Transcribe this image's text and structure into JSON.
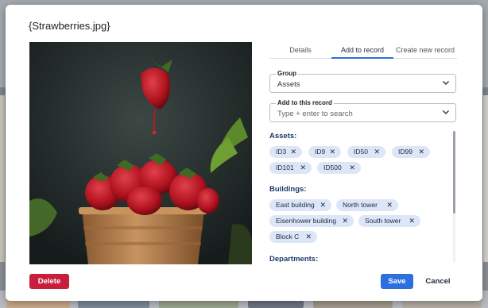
{
  "modal": {
    "title": "{Strawberries.jpg}"
  },
  "image": {
    "subject": "strawberries-in-paper-cup"
  },
  "tabs": [
    {
      "label": "Details",
      "active": false
    },
    {
      "label": "Add to record",
      "active": true
    },
    {
      "label": "Create new record",
      "active": false
    }
  ],
  "group_field": {
    "label": "Group",
    "value": "Assets"
  },
  "record_field": {
    "label": "Add to this record",
    "placeholder": "Type + enter to search"
  },
  "sections": {
    "assets": {
      "title": "Assets:",
      "chips": [
        "ID3",
        "ID9",
        "ID50",
        "ID99",
        "ID101",
        "ID500"
      ]
    },
    "buildings": {
      "title": "Buildings:",
      "chips": [
        "East building",
        "North tower",
        "Eisenhower building",
        "South tower",
        "Block C"
      ]
    },
    "departments": {
      "title": "Departments:"
    }
  },
  "chip_remove_symbol": "✕",
  "buttons": {
    "delete": "Delete",
    "save": "Save",
    "cancel": "Cancel"
  },
  "colors": {
    "accent": "#2e6fe0",
    "danger": "#c81e3c",
    "chip_bg": "#dce6f7",
    "section_title": "#1f3a68"
  }
}
